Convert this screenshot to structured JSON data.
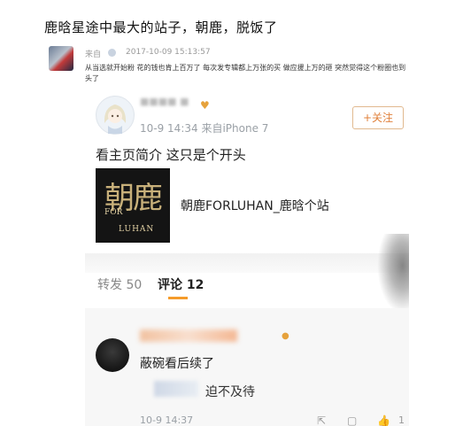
{
  "post": {
    "headline": "鹿晗星途中最大的站子，朝鹿，脱饭了",
    "author_name": "来自",
    "timestamp": "2017-10-09 15:13:57",
    "body": "从当选就开始粉 花的钱也肯上百万了 每次发专辑都上万张的买 做应援上万的砸 突然觉得这个粉圈也到头了"
  },
  "screenshot": {
    "time_source": "10-9 14:34  来自iPhone 7",
    "badge_icon": "heart-badge-icon",
    "follow_label": "+关注",
    "status_text": "看主页简介 这只是个开头",
    "link_card": {
      "thumb_main": "朝鹿",
      "thumb_for": "FOR",
      "thumb_luhan": "LUHAN",
      "title": "朝鹿FORLUHAN_鹿晗个站"
    },
    "tabs": {
      "repost": "转发 50",
      "comment": "评论 12"
    },
    "comments": [
      {
        "text": "蔽碗看后续了"
      },
      {
        "text": "迫不及待"
      }
    ],
    "comment_time": "10-9 14:37",
    "action_count": "1"
  },
  "colors": {
    "accent_orange": "#f59b2a",
    "follow_text": "#e0803a"
  }
}
